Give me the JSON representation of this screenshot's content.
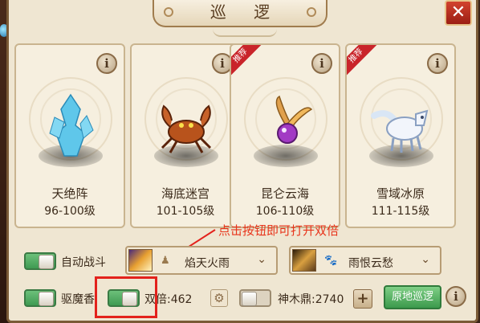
{
  "window": {
    "title": "巡 逻",
    "close_label": "✕"
  },
  "maps": [
    {
      "name": "天绝阵",
      "level": "96-100级",
      "recommended": false,
      "monster_icon": "ice-crystal-monster-icon"
    },
    {
      "name": "海底迷宫",
      "level": "101-105级",
      "recommended": false,
      "monster_icon": "crab-monster-icon"
    },
    {
      "name": "昆仑云海",
      "level": "106-110级",
      "recommended": true,
      "monster_icon": "purple-bird-monster-icon"
    },
    {
      "name": "雪域冰原",
      "level": "111-115级",
      "recommended": true,
      "monster_icon": "white-fox-monster-icon"
    }
  ],
  "recommend_badge": "推荐",
  "info_glyph": "i",
  "hint_text": "点击按钮即可打开双倍",
  "controls": {
    "auto_battle": {
      "label": "自动战斗",
      "on": true
    },
    "skill_select_1": {
      "value": "焰天火雨",
      "icon": "person-icon"
    },
    "skill_select_2": {
      "value": "雨恨云愁",
      "icon": "paw-icon"
    },
    "repel": {
      "label": "驱魔香",
      "on": true
    },
    "double": {
      "label": "双倍:462",
      "on": true
    },
    "shenmuding": {
      "label": "神木鼎:2740",
      "on": false
    },
    "patrol_here": "原地巡逻"
  },
  "colors": {
    "accent_red": "#e3221c",
    "toggle_green": "#4fae60",
    "panel": "#efe6d2"
  }
}
